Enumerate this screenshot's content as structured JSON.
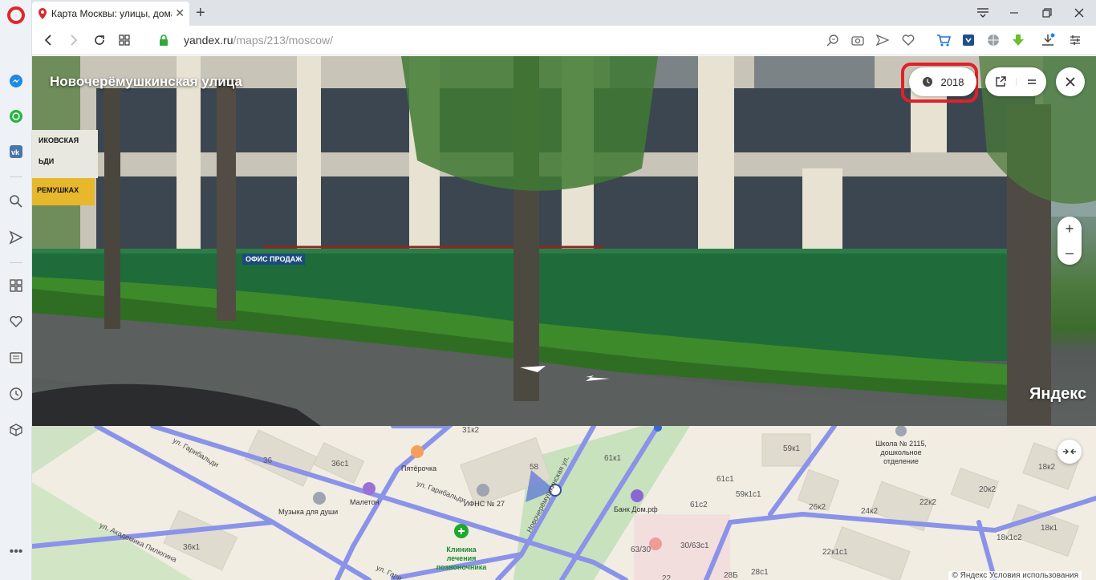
{
  "browser": {
    "tab_title": "Карта Москвы: улицы, дома",
    "url_host": "yandex.ru",
    "url_path": "/maps/213/moscow/"
  },
  "panorama": {
    "street_name": "Новочерёмушкинская улица",
    "year": "2018",
    "brand": "Яндекс",
    "signs": [
      "ИКОВСКАЯ",
      "ЬДИ",
      "РЕМУШКАХ",
      "ОФИС ПРОДАЖ"
    ],
    "zoom_in": "+",
    "zoom_out": "–"
  },
  "map": {
    "labels": {
      "l31k2": "31к2",
      "l36": "36",
      "l36c1": "36с1",
      "l58": "58",
      "l61k1": "61к1",
      "l59k1": "59к1",
      "l61c1": "61с1",
      "l59k1c1": "59к1с1",
      "l61c2": "61с2",
      "l26k2": "26к2",
      "l24k2": "24к2",
      "l22k2": "22к2",
      "l20k2": "20к2",
      "l18k2": "18к2",
      "l18k1c2": "18к1с2",
      "l18k1": "18к1",
      "l22k1c1": "22к1с1",
      "l63_30": "63/30",
      "l30_63c1": "30/63с1",
      "l36k1": "36к1",
      "l28b": "28Б",
      "l28c1": "28с1",
      "l22": "22"
    },
    "pois": {
      "pyaterochka": "Пятёрочка",
      "maleton": "Малетон",
      "ifns": "ИФНС № 27",
      "music": "Музыка для души",
      "bank": "Банк Дом.рф",
      "clinic": "Клиника лечения позвоночника",
      "school": "Школа № 2115, дошкольное отделение"
    },
    "streets": {
      "garibaldi1": "ул. Гарибальди",
      "garibaldi2": "ул. Гарибальди",
      "novoch": "Новочерёмушкинская ул.",
      "akad": "ул. Академика Пилюгина",
      "gar3": "ул. Гари"
    },
    "footer": "© Яндекс Условия использования"
  }
}
